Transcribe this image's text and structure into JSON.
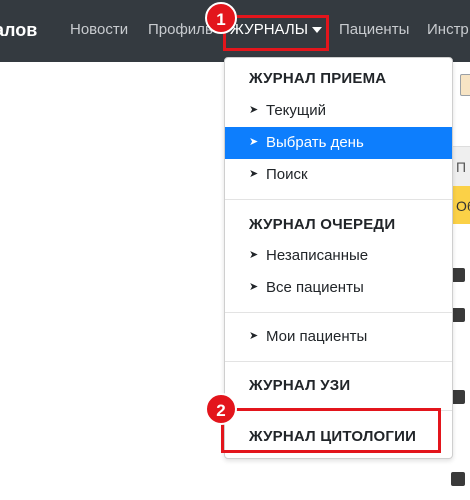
{
  "navbar": {
    "brand": "алов",
    "items": [
      {
        "key": "news",
        "label": "Новости"
      },
      {
        "key": "profile",
        "label": "Профиль"
      },
      {
        "key": "journals",
        "label": "ЖУРНАЛЫ"
      },
      {
        "key": "patients",
        "label": "Пациенты"
      },
      {
        "key": "tools",
        "label": "Инстр"
      }
    ]
  },
  "annotations": {
    "marker1": "1",
    "marker2": "2",
    "color": "#e3151c"
  },
  "dropdown": {
    "reception": {
      "heading": "ЖУРНАЛ ПРИЕМА",
      "items": [
        "Текущий",
        "Выбрать день",
        "Поиск"
      ]
    },
    "queue": {
      "heading": "ЖУРНАЛ ОЧЕРЕДИ",
      "items": [
        "Незаписанные",
        "Все пациенты"
      ]
    },
    "mine": {
      "items": [
        "Мои пациенты"
      ]
    },
    "uzi": {
      "heading": "ЖУРНАЛ УЗИ"
    },
    "cytology": {
      "heading": "ЖУРНАЛ ЦИТОЛОГИИ"
    },
    "active_item": "Выбрать день",
    "active_color": "#0d7efd"
  },
  "page_fragments": {
    "tab_char": "П",
    "yellow_char": "Об"
  }
}
